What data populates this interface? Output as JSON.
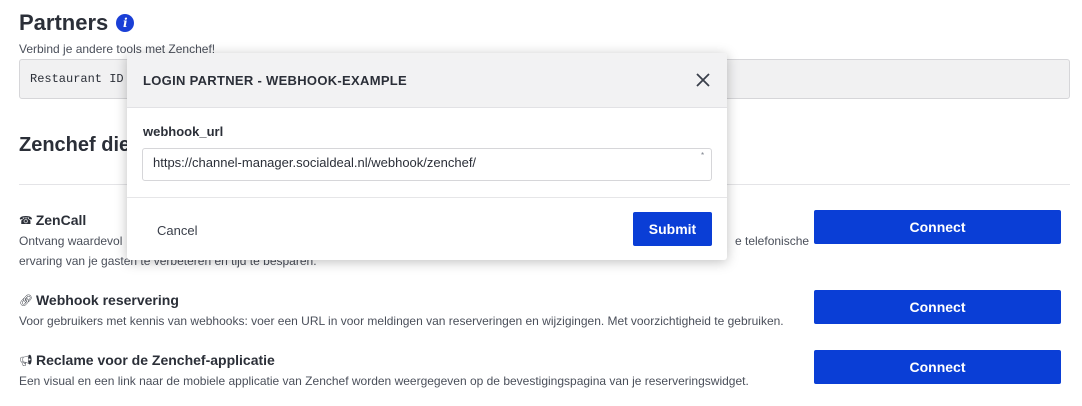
{
  "page": {
    "title": "Partners",
    "subtitle": "Verbind je andere tools met Zenchef!",
    "restaurant_field": "Restaurant ID",
    "section_title": "Zenchef die"
  },
  "services": [
    {
      "icon": "phone-icon",
      "title": "ZenCall",
      "desc_line1": "Ontvang waardevol",
      "desc_line1_tail": "e telefonische",
      "desc_line2": "ervaring van je gasten te verbeteren en tijd te besparen.",
      "button": "Connect"
    },
    {
      "icon": "link-icon",
      "title": "Webhook reservering",
      "desc": "Voor gebruikers met kennis van webhooks: voer een URL in voor meldingen van reserveringen en wijzigingen. Met voorzichtigheid te gebruiken.",
      "button": "Connect"
    },
    {
      "icon": "megaphone-icon",
      "title": "Reclame voor de Zenchef-applicatie",
      "desc": "Een visual en een link naar de mobiele applicatie van Zenchef worden weergegeven op de bevestigingspagina van je reserveringswidget.",
      "button": "Connect"
    }
  ],
  "modal": {
    "title": "LOGIN PARTNER - WEBHOOK-EXAMPLE",
    "field_label": "webhook_url",
    "field_value": "https://channel-manager.socialdeal.nl/webhook/zenchef/",
    "required_marker": "*",
    "cancel": "Cancel",
    "submit": "Submit"
  },
  "colors": {
    "primary": "#0a3ed6",
    "text": "#2b2f38",
    "muted": "#4a4f5a"
  }
}
